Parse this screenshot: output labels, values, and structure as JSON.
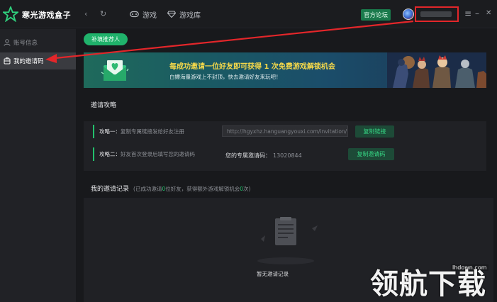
{
  "app": {
    "title": "寒光游戏盒子",
    "nav_back": "‹",
    "nav_refresh": "↻"
  },
  "topbar": {
    "tabs": [
      {
        "label": "游戏",
        "icon": "gamepad-icon"
      },
      {
        "label": "游戏库",
        "icon": "diamond-icon"
      }
    ],
    "official_forum": "官方论坛",
    "window_controls": {
      "menu": "≡",
      "minimize": "–",
      "close": "✕"
    }
  },
  "sidebar": {
    "items": [
      {
        "label": "账号信息",
        "icon": "user-icon",
        "active": false
      },
      {
        "label": "我的邀请码",
        "icon": "invite-code-icon",
        "active": true
      }
    ]
  },
  "main": {
    "tag_pill": "补填推荐人",
    "banner": {
      "title": "每成功邀请一位好友即可获得 1 次免费游戏解锁机会",
      "subtitle": "白嫖海量游戏上不封顶，快去邀请好友来玩吧！"
    },
    "strategy": {
      "title": "邀请攻略",
      "rows": [
        {
          "label": "攻略一：",
          "desc": "复制专属链接发给好友注册"
        },
        {
          "label": "攻略二：",
          "desc": "好友首次登录后填写您的邀请码"
        }
      ],
      "link_value": "http://hgyxhz.hanguangyouxi.com/invitation/",
      "copy_link_button": "复制链接",
      "code_label": "您的专属邀请码：",
      "code_value": "13020844",
      "copy_code_button": "复制邀请码"
    },
    "records": {
      "title": "我的邀请记录",
      "sub_prefix": "(已成功邀请",
      "invited_count": "0",
      "sub_middle": "位好友，获得额外游戏解锁机会",
      "extra_count": "0",
      "sub_suffix": "次)",
      "empty_text": "暂无邀请记录"
    }
  },
  "watermark": {
    "site": "lhdown.com",
    "brand": "领航下载"
  },
  "colors": {
    "accent_green": "#23c06c",
    "highlight_red": "#e3262a",
    "banner_yellow": "#f6d94a"
  }
}
